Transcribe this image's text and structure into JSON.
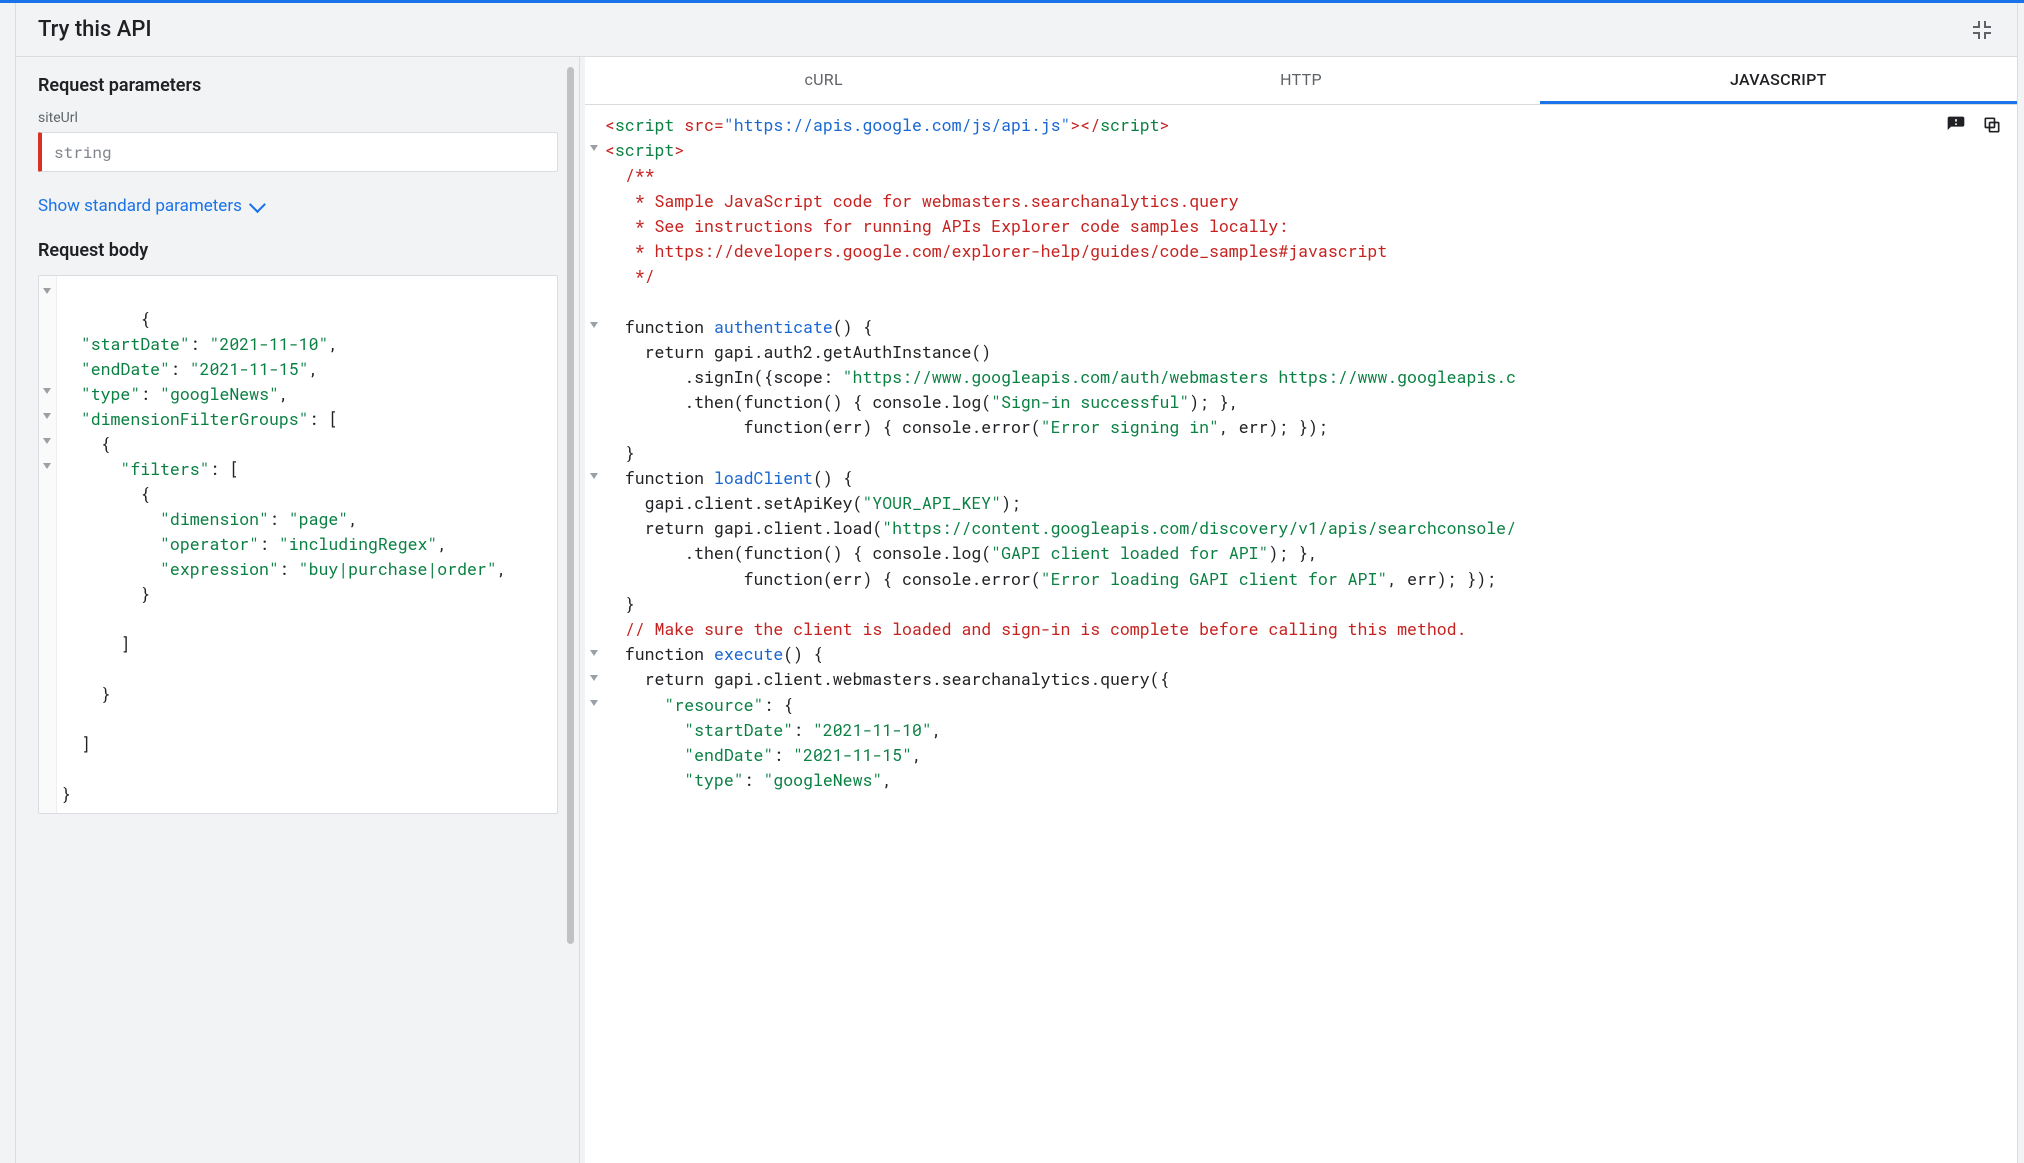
{
  "header": {
    "title": "Try this API"
  },
  "left": {
    "request_params_title": "Request parameters",
    "siteUrl_label": "siteUrl",
    "siteUrl_placeholder": "string",
    "show_standard_params": "Show standard parameters",
    "request_body_title": "Request body",
    "request_body": {
      "startDate": "2021-11-10",
      "endDate": "2021-11-15",
      "type": "googleNews",
      "dimensionFilterGroups": [
        {
          "filters": [
            {
              "dimension": "page",
              "operator": "includingRegex",
              "expression": "buy|purchase|order"
            }
          ]
        }
      ]
    }
  },
  "tabs": {
    "curl": "cURL",
    "http": "HTTP",
    "javascript": "JAVASCRIPT",
    "active": "javascript"
  },
  "code": {
    "script_src": "https://apis.google.com/js/api.js",
    "doc1": "Sample JavaScript code for webmasters.searchanalytics.query",
    "doc2": "See instructions for running APIs Explorer code samples locally:",
    "doc3": "https://developers.google.com/explorer-help/guides/code_samples#javascript",
    "scope_str": "https://www.googleapis.com/auth/webmasters https://www.googleapis.c",
    "signin_ok": "Sign-in successful",
    "signin_err": "Error signing in",
    "api_key": "YOUR_API_KEY",
    "discovery_url": "https://content.googleapis.com/discovery/v1/apis/searchconsole/",
    "gapi_ok": "GAPI client loaded for API",
    "gapi_err": "Error loading GAPI client for API",
    "load_comment": "// Make sure the client is loaded and sign-in is complete before calling this method.",
    "resource": {
      "startDate": "2021-11-10",
      "endDate": "2021-11-15",
      "type": "googleNews"
    }
  }
}
